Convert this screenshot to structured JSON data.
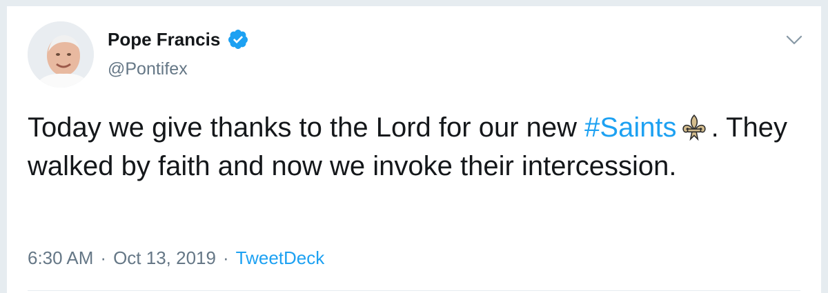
{
  "author": {
    "display_name": "Pope Francis",
    "handle": "@Pontifex",
    "verified": true,
    "avatar_icon": "avatar"
  },
  "tweet": {
    "text_before": "Today we give thanks to the Lord for our new ",
    "hashtag": "#Saints",
    "emoji_icon": "fleur-de-lis-icon",
    "text_after": ". They walked by faith and now we invoke their intercession."
  },
  "meta": {
    "time": "6:30 AM",
    "separator": "·",
    "date": "Oct 13, 2019",
    "source": "TweetDeck"
  },
  "colors": {
    "link": "#1da1f2",
    "secondary_text": "#657786",
    "primary_text": "#14171a"
  }
}
